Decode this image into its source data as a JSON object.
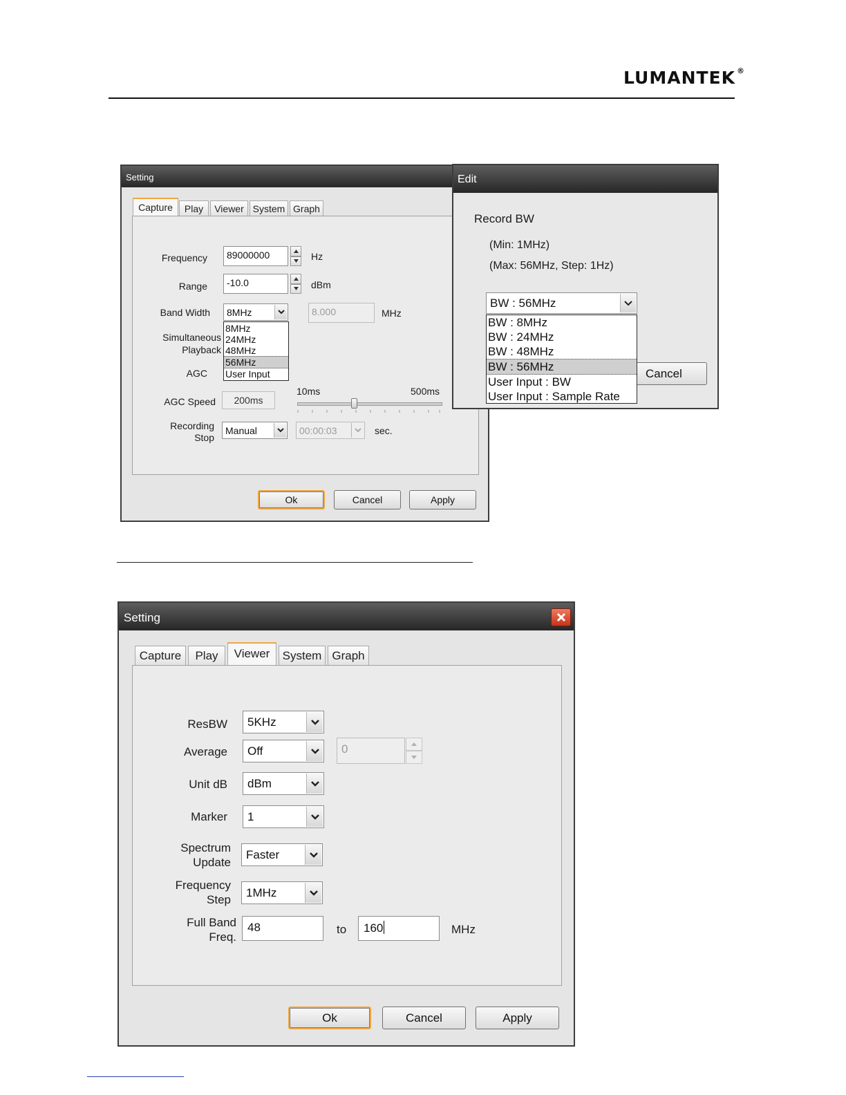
{
  "header": {
    "brand": "LUMANTEK",
    "registered": "®"
  },
  "capture_dialog": {
    "title": "Setting",
    "tabs": [
      "Capture",
      "Play",
      "Viewer",
      "System",
      "Graph"
    ],
    "frequency": {
      "label": "Frequency",
      "value": "89000000",
      "unit": "Hz"
    },
    "range": {
      "label": "Range",
      "value": "-10.0",
      "unit": "dBm"
    },
    "bandwidth": {
      "label": "Band Width",
      "value": "8MHz",
      "input": "8.000",
      "unit": "MHz",
      "options": [
        "8MHz",
        "24MHz",
        "48MHz",
        "56MHz",
        "User Input"
      ],
      "highlighted": "56MHz"
    },
    "simultaneous": {
      "line1": "Simultaneous",
      "line2": "Playback"
    },
    "agc": {
      "label": "AGC"
    },
    "agc_speed": {
      "label": "AGC Speed",
      "value": "200ms",
      "min": "10ms",
      "max": "500ms",
      "slider_fraction": 0.39
    },
    "recording_stop": {
      "line1": "Recording",
      "line2": "Stop",
      "mode": "Manual",
      "time": "00:00:03",
      "unit": "sec."
    },
    "buttons": {
      "ok": "Ok",
      "cancel": "Cancel",
      "apply": "Apply"
    }
  },
  "edit_dialog": {
    "title": "Edit",
    "heading": "Record BW",
    "min_text": "(Min: 1MHz)",
    "max_text": "(Max: 56MHz, Step: 1Hz)",
    "selected": "BW : 56MHz",
    "options": [
      "BW : 8MHz",
      "BW : 24MHz",
      "BW : 48MHz",
      "BW : 56MHz",
      "User Input : BW",
      "User Input : Sample Rate"
    ],
    "highlighted": "BW : 56MHz",
    "cancel": "Cancel"
  },
  "viewer_dialog": {
    "title": "Setting",
    "tabs": [
      "Capture",
      "Play",
      "Viewer",
      "System",
      "Graph"
    ],
    "resbw": {
      "label": "ResBW",
      "value": "5KHz"
    },
    "average": {
      "label": "Average",
      "value": "Off",
      "count": "0"
    },
    "unit_db": {
      "label": "Unit dB",
      "value": "dBm"
    },
    "marker": {
      "label": "Marker",
      "value": "1"
    },
    "spectrum_update": {
      "line1": "Spectrum",
      "line2": "Update",
      "value": "Faster"
    },
    "frequency_step": {
      "line1": "Frequency",
      "line2": "Step",
      "value": "1MHz"
    },
    "full_band": {
      "line1": "Full Band",
      "line2": "Freq.",
      "from": "48",
      "to_label": "to",
      "to": "160",
      "unit": "MHz"
    },
    "buttons": {
      "ok": "Ok",
      "cancel": "Cancel",
      "apply": "Apply"
    }
  }
}
